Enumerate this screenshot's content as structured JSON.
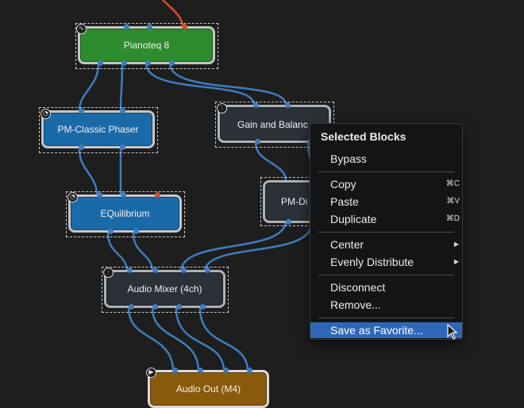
{
  "blocks": {
    "pianoteq": {
      "label": "Pianoteq 8",
      "icon": "audio-wave-icon"
    },
    "phaser": {
      "label": "PM-Classic Phaser",
      "icon": "knob-icon"
    },
    "gain": {
      "label": "Gain and Balanc",
      "icon": "mixer-sliders-icon"
    },
    "equilibrium": {
      "label": "EQuilibrium",
      "icon": "knob-icon"
    },
    "pmdi": {
      "label": "PM-Di",
      "icon": ""
    },
    "mixer": {
      "label": "Audio Mixer (4ch)",
      "icon": "mixer-sliders-icon"
    },
    "audioout": {
      "label": "Audio Out (M4)",
      "icon": "play-icon"
    }
  },
  "menu": {
    "header": "Selected Blocks",
    "items": [
      {
        "label": "Bypass",
        "shortcut": ""
      },
      {
        "label": "Copy",
        "shortcut": "⌘C"
      },
      {
        "label": "Paste",
        "shortcut": "⌘V"
      },
      {
        "label": "Duplicate",
        "shortcut": "⌘D"
      },
      {
        "label": "Center",
        "submenu": true
      },
      {
        "label": "Evenly Distribute",
        "submenu": true
      },
      {
        "label": "Disconnect",
        "shortcut": ""
      },
      {
        "label": "Remove...",
        "shortcut": ""
      },
      {
        "label": "Save as Favorite...",
        "shortcut": "",
        "highlighted": true
      }
    ]
  },
  "colors": {
    "background": "#1e1e1e",
    "wire": "#3f7dbe",
    "wire_active": "#d0502e",
    "menu_highlight": "#2f67b8"
  }
}
